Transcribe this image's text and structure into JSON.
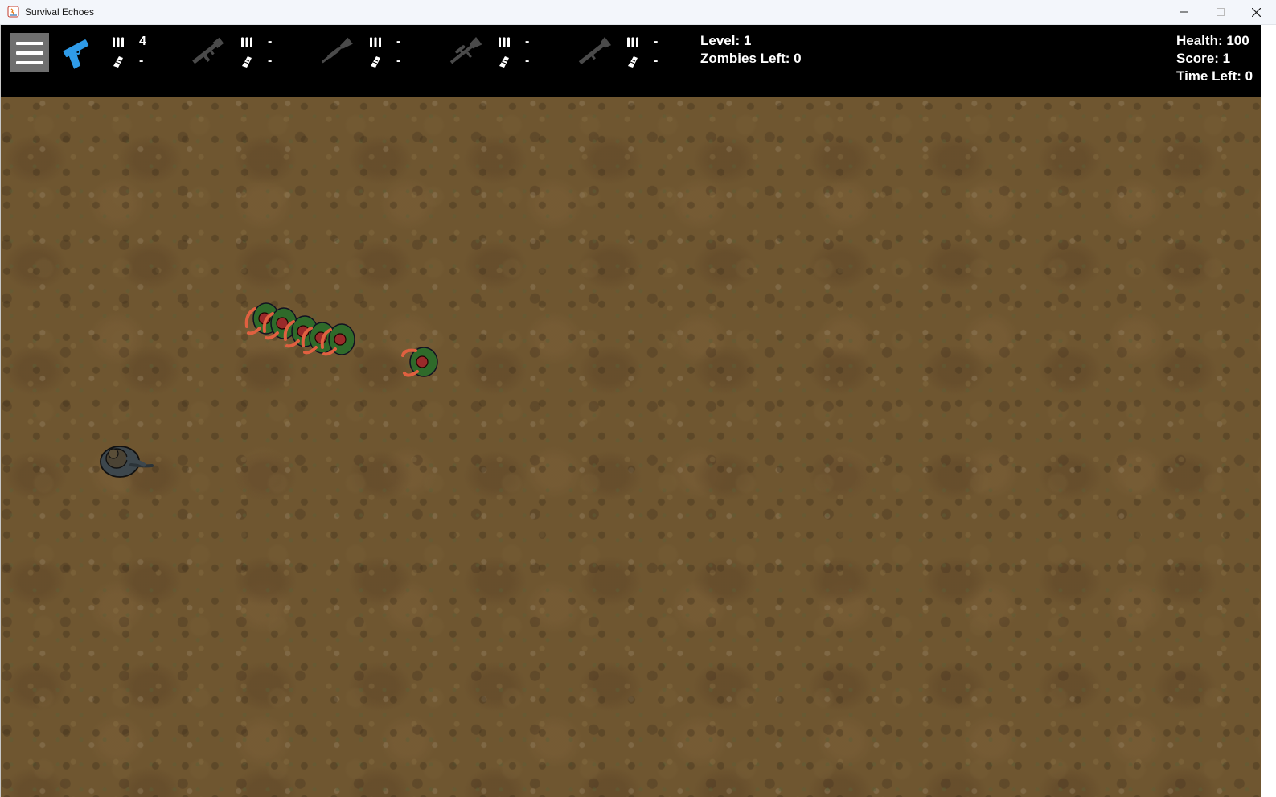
{
  "window": {
    "title": "Survival Echoes"
  },
  "hud": {
    "menu_button": "menu-icon",
    "weapons": [
      {
        "icon": "pistol-icon",
        "selected": true,
        "color": "#2f9be8",
        "loaded": "4",
        "reserve": "-"
      },
      {
        "icon": "assault-rifle-icon",
        "selected": false,
        "color": "#4a4a4a",
        "loaded": "-",
        "reserve": "-"
      },
      {
        "icon": "shotgun-icon",
        "selected": false,
        "color": "#4a4a4a",
        "loaded": "-",
        "reserve": "-"
      },
      {
        "icon": "sniper-rifle-icon",
        "selected": false,
        "color": "#4a4a4a",
        "loaded": "-",
        "reserve": "-"
      },
      {
        "icon": "rocket-launcher-icon",
        "selected": false,
        "color": "#4a4a4a",
        "loaded": "-",
        "reserve": "-"
      }
    ],
    "level": "Level: 1",
    "zombies_left": "Zombies Left: 0",
    "health": "Health: 100",
    "score": "Score: 1",
    "time_left": "Time Left: 0"
  },
  "field": {
    "ground_color": "#6f5630",
    "entities": [
      "zombie",
      "zombie",
      "zombie",
      "zombie",
      "zombie",
      "zombie",
      "player"
    ]
  }
}
